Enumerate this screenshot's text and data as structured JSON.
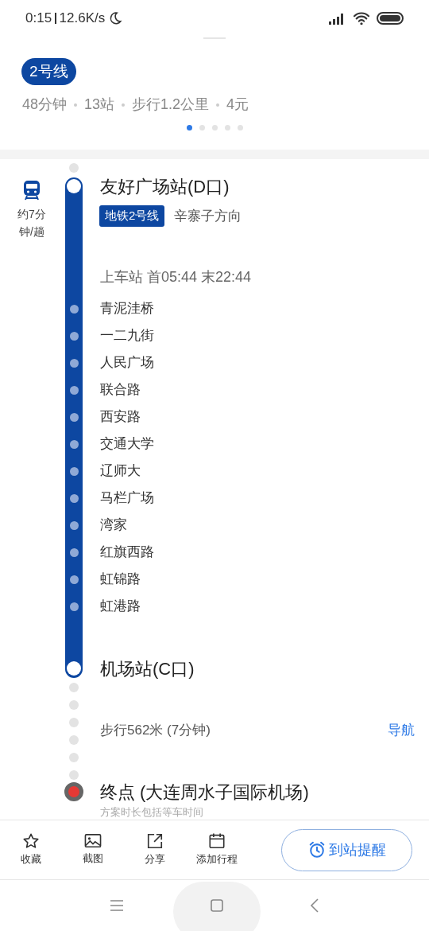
{
  "status_bar": {
    "time": "0:15",
    "network_speed": "12.6K/s"
  },
  "route": {
    "line_badge": "2号线",
    "summary": [
      "48分钟",
      "13站",
      "步行1.2公里",
      "4元"
    ],
    "pages": [
      {
        "selected": true
      },
      {
        "selected": false
      },
      {
        "selected": false
      },
      {
        "selected": false
      },
      {
        "selected": false
      }
    ]
  },
  "timeline": {
    "headway": "约7分钟/趟",
    "start_station": "友好广场站(D口)",
    "line_tag": "地铁2号线",
    "direction": "辛寨子方向",
    "boarding": "上车站 首05:44 末22:44",
    "stops": [
      "青泥洼桥",
      "一二九街",
      "人民广场",
      "联合路",
      "西安路",
      "交通大学",
      "辽师大",
      "马栏广场",
      "湾家",
      "红旗西路",
      "虹锦路",
      "虹港路"
    ],
    "end_station": "机场站(C口)",
    "walk": {
      "text": "步行562米 (7分钟)",
      "action": "导航"
    },
    "destination": "终点 (大连周水子国际机场)",
    "note": "方案时长包括等车时间"
  },
  "toolbar": {
    "actions": [
      {
        "kind": "star",
        "label": "收藏"
      },
      {
        "kind": "image",
        "label": "截图"
      },
      {
        "kind": "share",
        "label": "分享"
      },
      {
        "kind": "calendar",
        "label": "添加行程"
      }
    ],
    "reminder": "到站提醒"
  }
}
